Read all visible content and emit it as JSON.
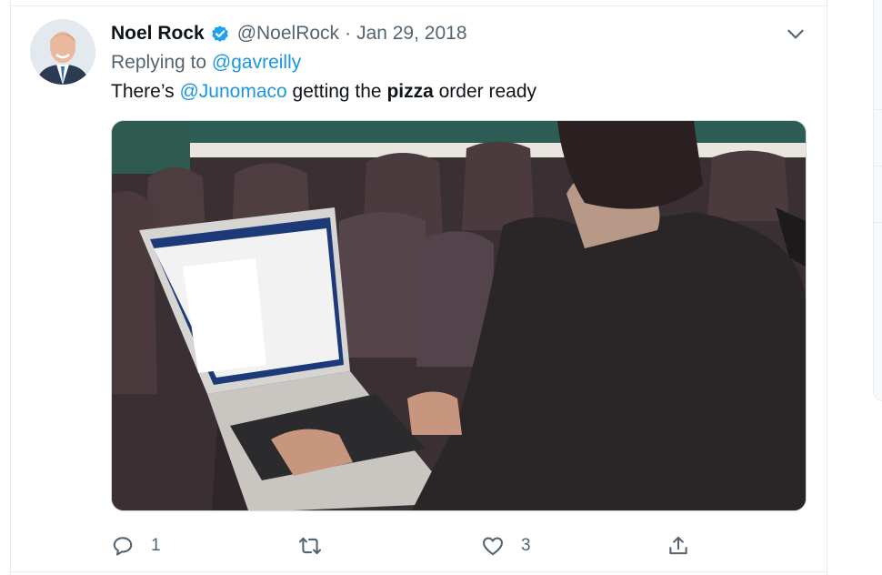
{
  "tweet": {
    "author": {
      "display_name": "Noel Rock",
      "handle": "@NoelRock",
      "verified": true,
      "avatar_icon": "profile-photo"
    },
    "separator": "·",
    "date": "Jan 29, 2018",
    "replying_to_prefix": "Replying to",
    "replying_to_handle": "@gavreilly",
    "text": {
      "part1": "There’s ",
      "mention": "@Junomaco",
      "part2": " getting the ",
      "bold": "pizza",
      "part3": " order ready"
    },
    "media": {
      "icon": "photo-image"
    },
    "actions": {
      "reply_count": "1",
      "retweet_count": "",
      "like_count": "3"
    }
  },
  "colors": {
    "link": "#1b95e0",
    "secondary_text": "#536471",
    "verified_badge": "#1da1f2",
    "divider": "#e6ecf0"
  }
}
